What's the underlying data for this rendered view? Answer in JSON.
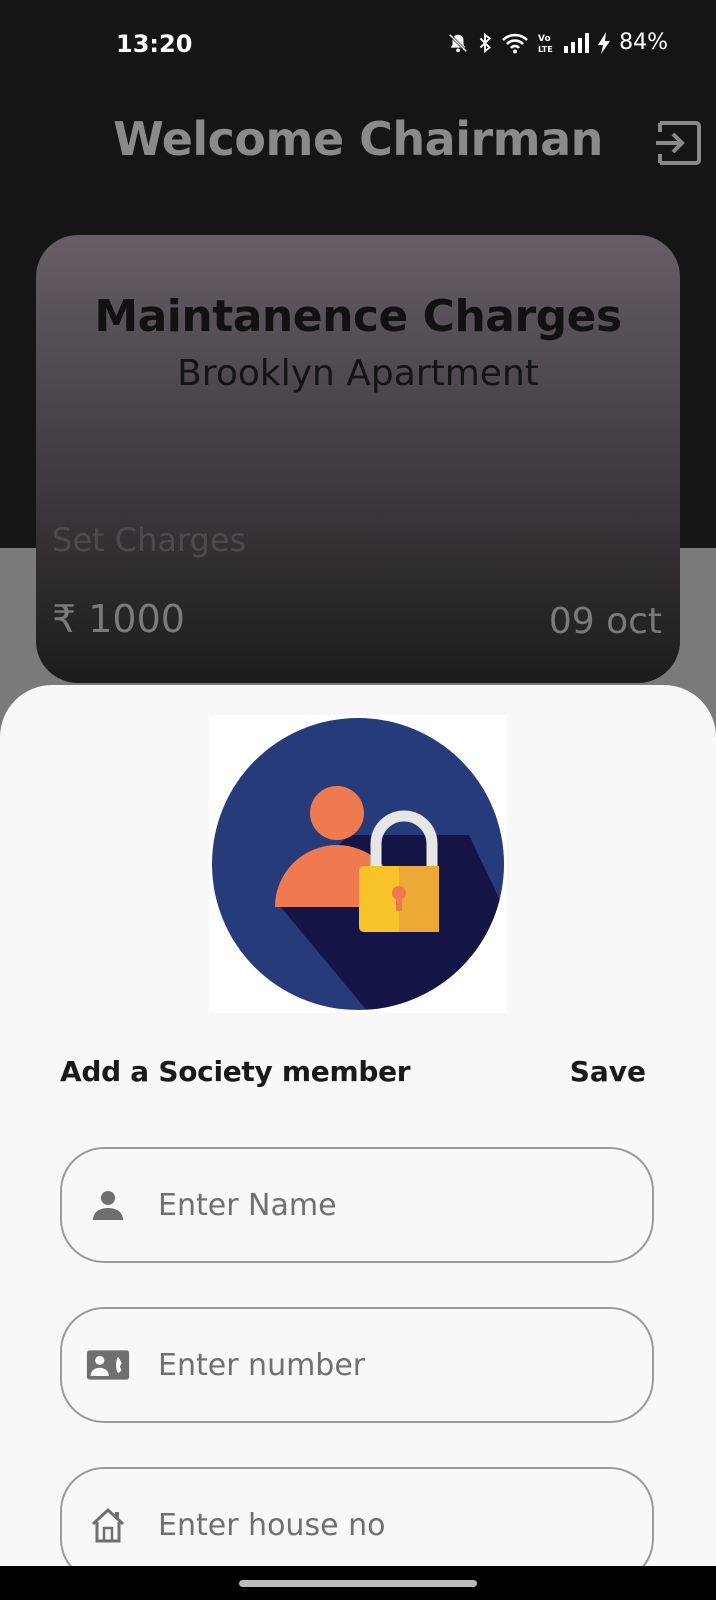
{
  "status_bar": {
    "time": "13:20",
    "battery": "84%",
    "icons": [
      "mute-bell-icon",
      "bluetooth-icon",
      "wifi-icon",
      "volte-icon",
      "signal-icon",
      "charging-icon"
    ]
  },
  "header": {
    "title": "Welcome Chairman",
    "logout_icon": "logout-icon"
  },
  "card": {
    "title": "Maintanence Charges",
    "subtitle": "Brooklyn Apartment",
    "set_label": "Set Charges",
    "amount": "₹ 1000",
    "date": "09 oct"
  },
  "sheet": {
    "illustration": "user-lock-illustration",
    "title": "Add a Society member",
    "save_label": "Save",
    "fields": [
      {
        "icon": "person-icon",
        "placeholder": "Enter Name",
        "value": ""
      },
      {
        "icon": "contact-phone-icon",
        "placeholder": "Enter number",
        "value": ""
      },
      {
        "icon": "house-icon",
        "placeholder": "Enter house no",
        "value": ""
      }
    ]
  },
  "colors": {
    "background_dark": "#151515",
    "scrim": "#7a7a7a",
    "sheet": "#f8f8f8",
    "illustration_circle": "#273a7a",
    "illustration_person": "#f07a50",
    "illustration_lock": "#f7c328"
  }
}
